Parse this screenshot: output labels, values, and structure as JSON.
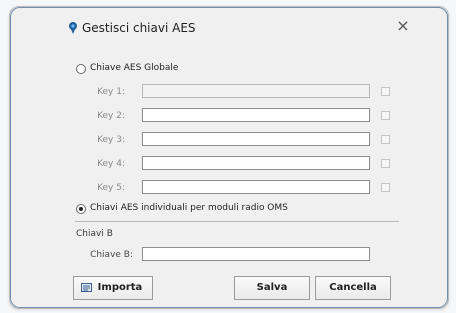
{
  "dialog": {
    "title": "Gestisci chiavi AES",
    "close_glyph": "×",
    "title_icon": "pin-icon"
  },
  "global_mode": {
    "label": "Chiave AES Globale",
    "selected": false,
    "keys": [
      {
        "label": "Key 1:",
        "value": "",
        "enabled": false
      },
      {
        "label": "Key 2:",
        "value": "",
        "enabled": true
      },
      {
        "label": "Key 3:",
        "value": "",
        "enabled": true
      },
      {
        "label": "Key 4:",
        "value": "",
        "enabled": true
      },
      {
        "label": "Key 5:",
        "value": "",
        "enabled": true
      }
    ]
  },
  "individual_mode": {
    "label": "Chiavi AES individuali per moduli radio OMS",
    "selected": true
  },
  "chiavi_b": {
    "section_label": "Chiavi B",
    "field_label": "Chiave B:",
    "value": ""
  },
  "buttons": {
    "import": "Importa",
    "save": "Salva",
    "cancel": "Cancella"
  },
  "colors": {
    "accent": "#1f5f9a",
    "dialog_bg": "#f0f0f0"
  }
}
